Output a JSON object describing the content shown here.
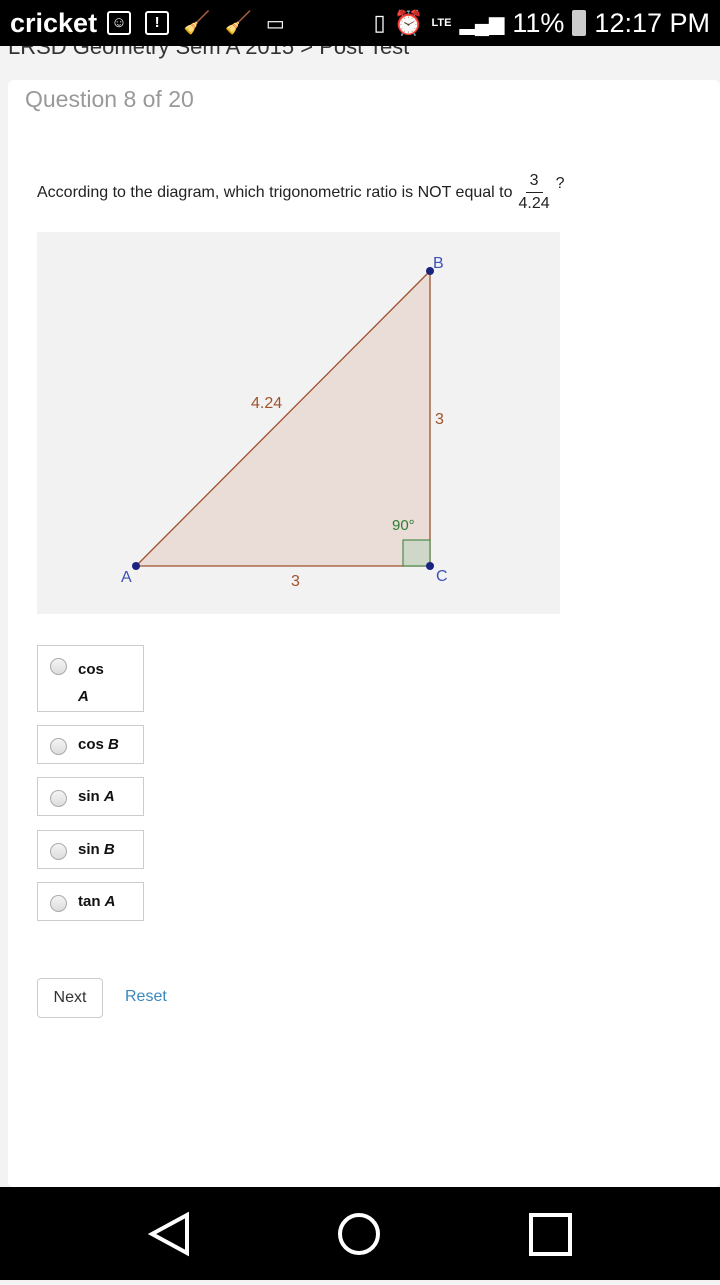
{
  "status_bar": {
    "carrier": "cricket",
    "battery": "11%",
    "time": "12:17 PM",
    "network": "LTE"
  },
  "breadcrumb": "LRSD Geometry Sem A 2015 > Post Test",
  "question": {
    "number_label": "Question 8 of 20",
    "prompt": "According to the diagram, which trigonometric ratio is NOT equal to",
    "fraction_numerator": "3",
    "fraction_denominator": "4.24",
    "suffix": "?"
  },
  "diagram": {
    "vertex_a": "A",
    "vertex_b": "B",
    "vertex_c": "C",
    "hypotenuse": "4.24",
    "side_bc": "3",
    "side_ac": "3",
    "angle_c": "90°"
  },
  "options": [
    {
      "fn": "cos",
      "var": "A"
    },
    {
      "fn": "cos",
      "var": "B"
    },
    {
      "fn": "sin",
      "var": "A"
    },
    {
      "fn": "sin",
      "var": "B"
    },
    {
      "fn": "tan",
      "var": "A"
    }
  ],
  "buttons": {
    "next": "Next",
    "reset": "Reset"
  }
}
